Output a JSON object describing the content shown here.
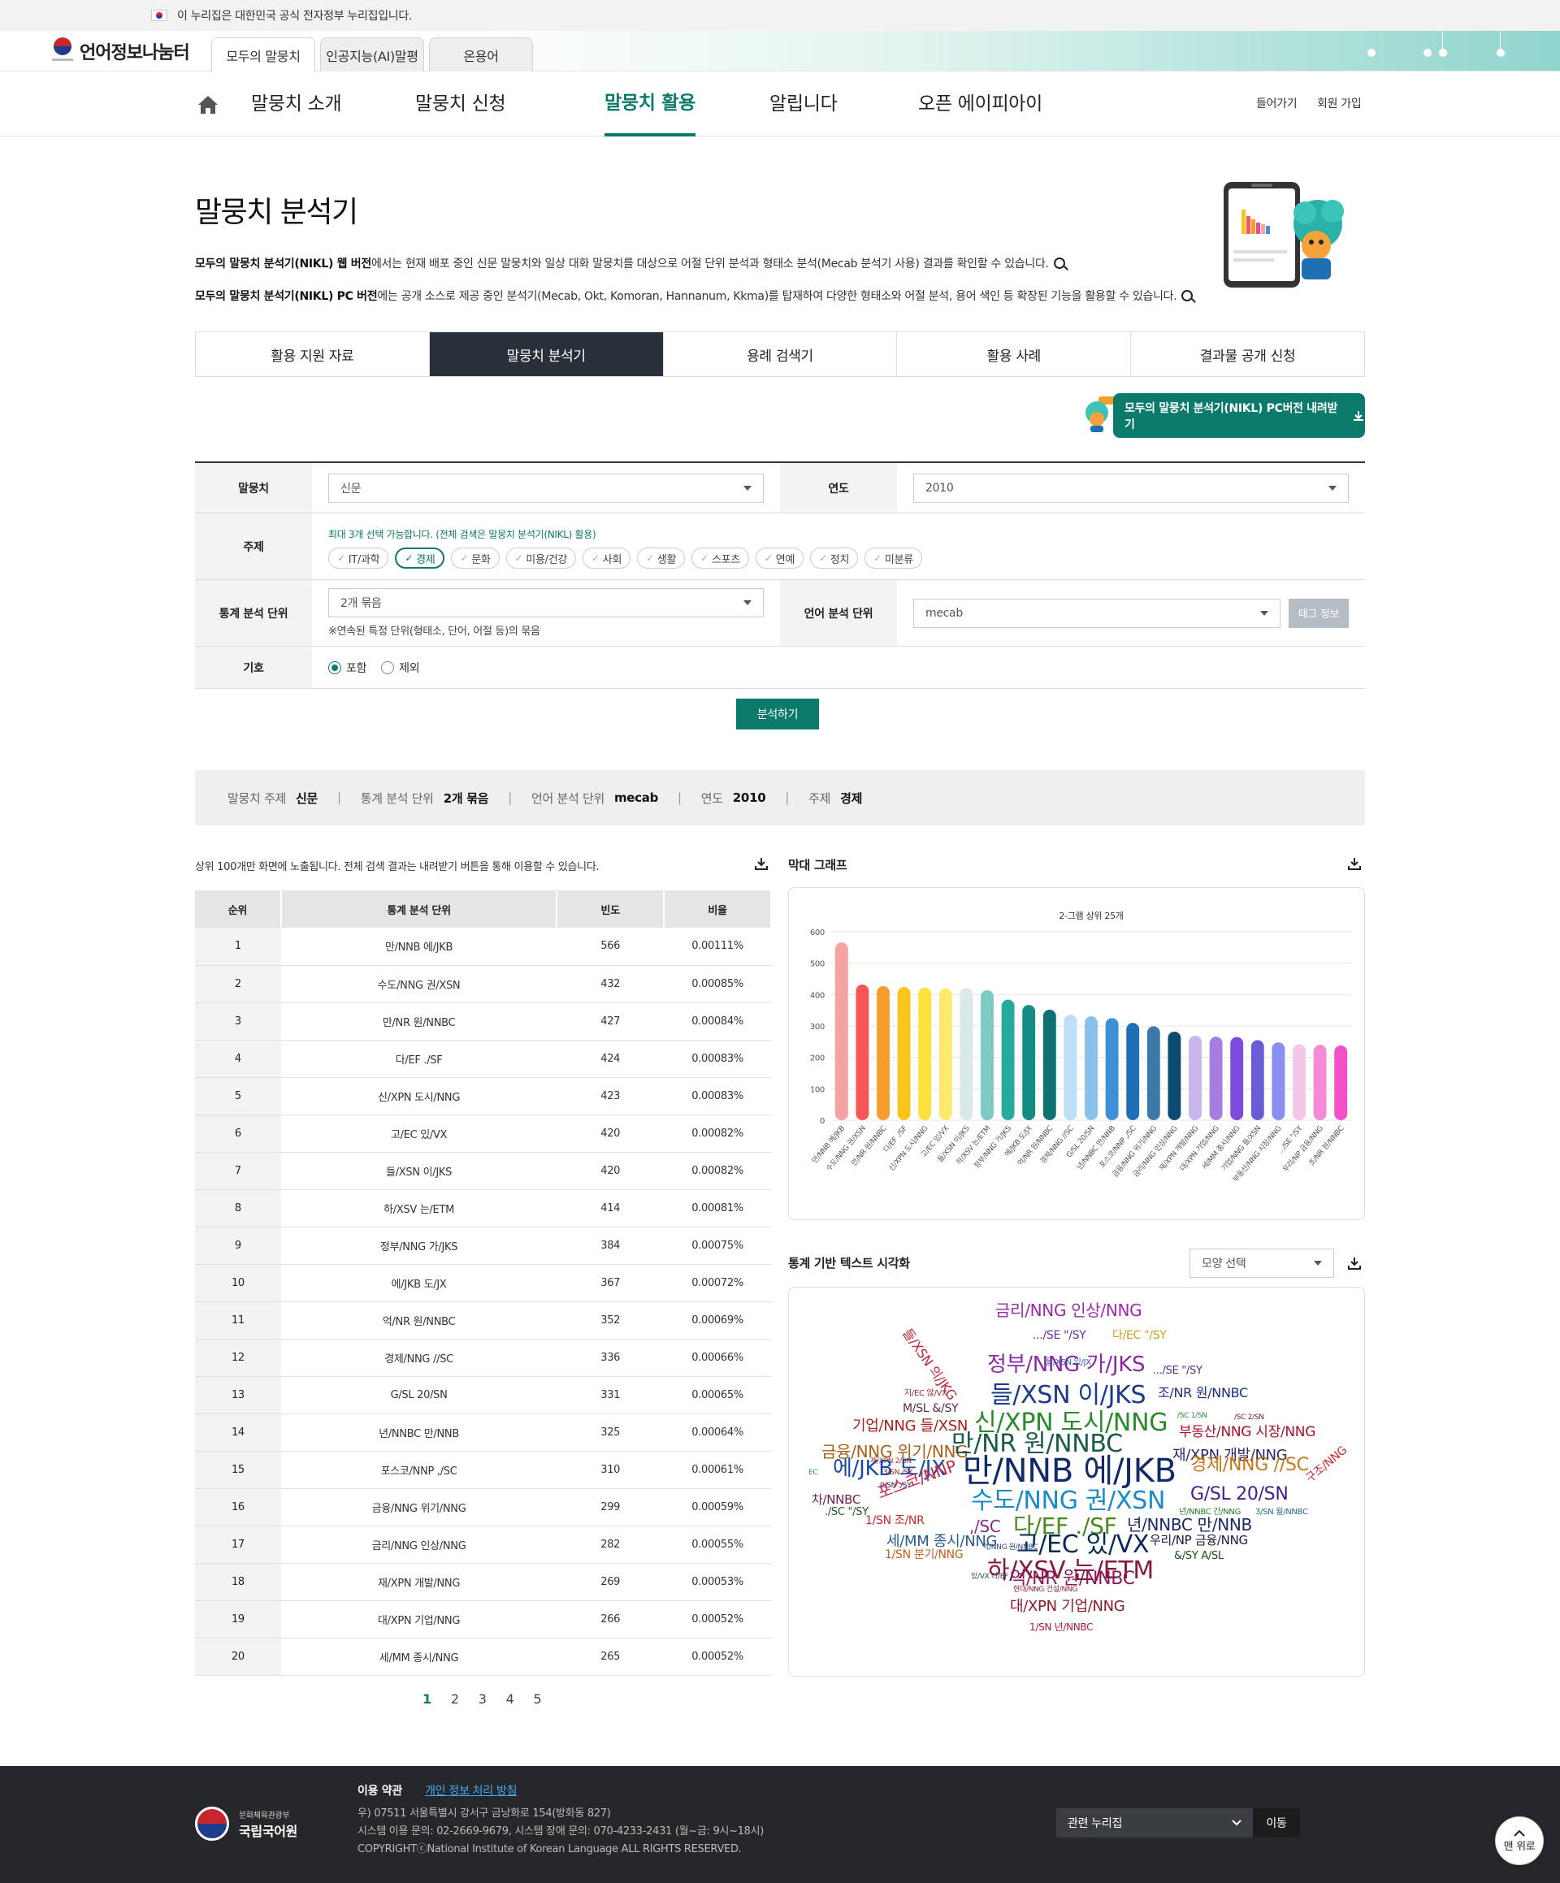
{
  "gov_banner": "이 누리집은 대한민국 공식 전자정부 누리집입니다.",
  "logo": "언어정보나눔터",
  "site_tabs": [
    "모두의 말뭉치",
    "인공지능(AI)말평",
    "온용어"
  ],
  "gnb": [
    "말뭉치 소개",
    "말뭉치 신청",
    "말뭉치 활용",
    "알립니다",
    "오픈 에이피아이"
  ],
  "util": {
    "login": "들어가기",
    "join": "회원 가입"
  },
  "page_title": "말뭉치 분석기",
  "desc1": {
    "bold": "모두의 말뭉치 분석기(NIKL) 웹 버전",
    "text": "에서는 현재 배포 중인 신문 말뭉치와 일상 대화 말뭉치를 대상으로 어절 단위 분석과 형태소 분석(Mecab 분석기 사용) 결과를 확인할 수 있습니다."
  },
  "desc2": {
    "bold": "모두의 말뭉치 분석기(NIKL) PC 버전",
    "text": "에는 공개 소스로 제공 중인 분석기(Mecab, Okt, Komoran, Hannanum, Kkma)를 탑재하여 다양한 형태소와 어절 분석, 용어 색인 등 확장된 기능을 활용할 수 있습니다."
  },
  "subtabs": [
    "활용 지원 자료",
    "말뭉치 분석기",
    "용례 검색기",
    "활용 사례",
    "결과물 공개 신청"
  ],
  "download_btn": "모두의 말뭉치 분석기(NIKL) PC버전 내려받기",
  "form": {
    "corpus_label": "말뭉치",
    "corpus_value": "신문",
    "year_label": "연도",
    "year_value": "2010",
    "topic_label": "주제",
    "topic_note": "최대 3개 선택 가능합니다. (전체 검색은 말뭉치 분석기(NIKL) 활용)",
    "topics": [
      "IT/과학",
      "경제",
      "문화",
      "미용/건강",
      "사회",
      "생활",
      "스포츠",
      "연예",
      "정치",
      "미분류"
    ],
    "unit_label": "통계 분석 단위",
    "unit_value": "2개 묶음",
    "unit_note": "※연속된 특정 단위(형태소, 단어, 어절 등)의 묶음",
    "lang_label": "언어 분석 단위",
    "lang_value": "mecab",
    "tag_btn": "태그 정보",
    "symbol_label": "기호",
    "symbol_on": "포함",
    "symbol_off": "제외",
    "analyze": "분석하기"
  },
  "summary": [
    {
      "k": "말뭉치 주제",
      "v": "신문"
    },
    {
      "k": "통계 분석 단위",
      "v": "2개 묶음"
    },
    {
      "k": "언어 분석 단위",
      "v": "mecab"
    },
    {
      "k": "연도",
      "v": "2010"
    },
    {
      "k": "주제",
      "v": "경제"
    }
  ],
  "table_note": "상위 100개만 화면에 노출됩니다. 전체 검색 결과는 내려받기 버튼을 통해 이용할 수 있습니다.",
  "table": {
    "headers": [
      "순위",
      "통계 분석 단위",
      "빈도",
      "비율"
    ],
    "rows": [
      [
        "1",
        "만/NNB 에/JKB",
        "566",
        "0.00111%"
      ],
      [
        "2",
        "수도/NNG 권/XSN",
        "432",
        "0.00085%"
      ],
      [
        "3",
        "만/NR 원/NNBC",
        "427",
        "0.00084%"
      ],
      [
        "4",
        "다/EF ./SF",
        "424",
        "0.00083%"
      ],
      [
        "5",
        "신/XPN 도시/NNG",
        "423",
        "0.00083%"
      ],
      [
        "6",
        "고/EC 있/VX",
        "420",
        "0.00082%"
      ],
      [
        "7",
        "들/XSN 이/JKS",
        "420",
        "0.00082%"
      ],
      [
        "8",
        "하/XSV 는/ETM",
        "414",
        "0.00081%"
      ],
      [
        "9",
        "정부/NNG 가/JKS",
        "384",
        "0.00075%"
      ],
      [
        "10",
        "에/JKB 도/JX",
        "367",
        "0.00072%"
      ],
      [
        "11",
        "억/NR 원/NNBC",
        "352",
        "0.00069%"
      ],
      [
        "12",
        "경제/NNG //SC",
        "336",
        "0.00066%"
      ],
      [
        "13",
        "G/SL 20/SN",
        "331",
        "0.00065%"
      ],
      [
        "14",
        "년/NNBC 만/NNB",
        "325",
        "0.00064%"
      ],
      [
        "15",
        "포스코/NNP ,/SC",
        "310",
        "0.00061%"
      ],
      [
        "16",
        "금융/NNG 위기/NNG",
        "299",
        "0.00059%"
      ],
      [
        "17",
        "금리/NNG 인상/NNG",
        "282",
        "0.00055%"
      ],
      [
        "18",
        "재/XPN 개발/NNG",
        "269",
        "0.00053%"
      ],
      [
        "19",
        "대/XPN 기업/NNG",
        "266",
        "0.00052%"
      ],
      [
        "20",
        "세/MM 종시/NNG",
        "265",
        "0.00052%"
      ]
    ]
  },
  "pager": [
    "1",
    "2",
    "3",
    "4",
    "5"
  ],
  "bar_section_title": "막대 그래프",
  "wc_section_title": "통계 기반 텍스트 시각화",
  "shape_select": "모양 선택",
  "chart_data": {
    "type": "bar",
    "title": "2-그램 상위 25개",
    "ylim": [
      0,
      600
    ],
    "yticks": [
      0,
      100,
      200,
      300,
      400,
      500,
      600
    ],
    "categories": [
      "만/NNB 에/JKB",
      "수도/NNG 권/XSN",
      "만/NR 원/NNBC",
      "다/EF ./SF",
      "신/XPN 도시/NNG",
      "고/EC 있/VX",
      "들/XSN 이/JKS",
      "하/XSV 는/ETM",
      "정부/NNG 가/JKS",
      "에/JKB 도/JX",
      "억/NR 원/NNBC",
      "경제/NNG //SC",
      "G/SL 20/SN",
      "년/NNBC 만/NNB",
      "포스코/NNP ,/SC",
      "금융/NNG 위기/NNG",
      "금리/NNG 인상/NNG",
      "재/XPN 개발/NNG",
      "대/XPN 기업/NNG",
      "세/MM 종시/NNG",
      "기업/NNG 들/XSN",
      "부동산/NNG 시장/NNG",
      ".../SE \"/SY",
      "우리/NP 금융/NNG",
      "조/NR 원/NNBC"
    ],
    "values": [
      566,
      432,
      427,
      424,
      423,
      420,
      420,
      414,
      384,
      367,
      352,
      336,
      331,
      325,
      310,
      299,
      282,
      269,
      266,
      265,
      255,
      248,
      242,
      240,
      238
    ],
    "colors": [
      "#f6a2a2",
      "#f65656",
      "#f59e2e",
      "#f9c51c",
      "#fbe23c",
      "#fde96e",
      "#dbe8ea",
      "#7ecac4",
      "#26aaa0",
      "#148c80",
      "#0e7272",
      "#bde0f6",
      "#88c2ec",
      "#3d8fd8",
      "#1f6fb4",
      "#3c78a8",
      "#0d4a72",
      "#c8b6ec",
      "#a57ee0",
      "#7d4adc",
      "#6a5cd4",
      "#8a8ef0",
      "#f6c6e6",
      "#f68ad6",
      "#f250c8"
    ]
  },
  "wordcloud": [
    {
      "t": "금리/NNG 인상/NNG",
      "c": "#9b2aa8",
      "s": 20
    },
    {
      "t": ".../SE \"/SY",
      "c": "#6a2ca0",
      "s": 14
    },
    {
      "t": "다/EC \"/SY",
      "c": "#c8a020",
      "s": 14
    },
    {
      "t": "들/XSN 의/JKG",
      "c": "#c0283c",
      "s": 16
    },
    {
      "t": "정부/NNG 가/JKS",
      "c": "#8a28a8",
      "s": 26
    },
    {
      "t": "들/XSN 있/JX",
      "c": "#3050a0",
      "s": 10
    },
    {
      "t": ".../SE \"/SY",
      "c": "#5a2a8a",
      "s": 13
    },
    {
      "t": "지/EC 않/VX",
      "c": "#a82a2a",
      "s": 10
    },
    {
      "t": "M/SL &/SY",
      "c": "#5a2a40",
      "s": 14
    },
    {
      "t": "들/XSN 이/JKS",
      "c": "#1a3a8a",
      "s": 30
    },
    {
      "t": "조/NR 원/NNBC",
      "c": "#1a2a7a",
      "s": 16
    },
    {
      "t": "/SC 1/SN",
      "c": "#2a8a3a",
      "s": 9
    },
    {
      "t": "/SC 2/SN",
      "c": "#6a2a2a",
      "s": 9
    },
    {
      "t": "기업/NNG 들/XSN",
      "c": "#a8201a",
      "s": 18
    },
    {
      "t": "신/XPN 도시/NNG",
      "c": "#2a8a2a",
      "s": 30
    },
    {
      "t": "부동산/NNG 시장/NNG",
      "c": "#a8102a",
      "s": 17
    },
    {
      "t": "금융/NNG 위기/NNG",
      "c": "#a8601a",
      "s": 20
    },
    {
      "t": "만/NR 원/NNBC",
      "c": "#1a5a4a",
      "s": 30
    },
    {
      "t": "재/XPN 개발/NNG",
      "c": "#2a2a6a",
      "s": 18
    },
    {
      "t": "제/XPN 2/SN",
      "c": "#c82a2a",
      "s": 9
    },
    {
      "t": "에/JKB 도/JX",
      "c": "#1a4aa8",
      "s": 26
    },
    {
      "t": "만/NNB 에/JKB",
      "c": "#102a6a",
      "s": 40
    },
    {
      "t": "경제/NNG //SC",
      "c": "#c87a1a",
      "s": 22
    },
    {
      "t": "EC",
      "c": "#2a8a8a",
      "s": 9
    },
    {
      "t": "3/SN /SY",
      "c": "#8a2a2a",
      "s": 9
    },
    {
      "t": "0/SN ./SY",
      "c": "#1a1a6a",
      "s": 9
    },
    {
      "t": "차/NNBC",
      "c": "#6a1a4a",
      "s": 15
    },
    {
      "t": "포스코/NNP",
      "c": "#c82a4a",
      "s": 20
    },
    {
      "t": "수도/NNG 권/XSN",
      "c": "#1a8ac8",
      "s": 30
    },
    {
      "t": "G/SL 20/SN",
      "c": "#4a1a8a",
      "s": 22
    },
    {
      "t": "구조/NNG",
      "c": "#c82a2a",
      "s": 14
    },
    {
      "t": "./SC \"/SY",
      "c": "#1a5a1a",
      "s": 13
    },
    {
      "t": "년/NNBC 간/NNG",
      "c": "#2a7a2a",
      "s": 10
    },
    {
      "t": "3/SN 월/NNBC",
      "c": "#2a6a8a",
      "s": 10
    },
    {
      "t": "1/SN 조/NR",
      "c": "#c82a2a",
      "s": 14
    },
    {
      "t": ",/SC",
      "c": "#8a2a8a",
      "s": 20
    },
    {
      "t": "다/EF ./SF",
      "c": "#4a8a1a",
      "s": 28
    },
    {
      "t": "년/NNBC 만/NNB",
      "c": "#1a2a6a",
      "s": 20
    },
    {
      "t": "세/MM 종시/NNG",
      "c": "#2a5a8a",
      "s": 18
    },
    {
      "t": "고/EC 있/VX",
      "c": "#0a2a5a",
      "s": 30
    },
    {
      "t": "우리/NP 금융/NNG",
      "c": "#1a1a3a",
      "s": 15
    },
    {
      "t": "억/NNG 원/NNBC",
      "c": "#2a4a8a",
      "s": 9
    },
    {
      "t": "1/SN 분기/NNG",
      "c": "#c8601a",
      "s": 14
    },
    {
      "t": "&/SY A/SL",
      "c": "#1a4a1a",
      "s": 13
    },
    {
      "t": "하/XSV 는/ETM",
      "c": "#8a1a3a",
      "s": 30
    },
    {
      "t": "있/VX 다/EF",
      "c": "#2a4a6a",
      "s": 9
    },
    {
      "t": "억/NR 원/NNBC",
      "c": "#8a1a5a",
      "s": 22
    },
    {
      "t": "현대/NNG 건설/NNG",
      "c": "#8a2a3a",
      "s": 9
    },
    {
      "t": "대/XPN 기업/NNG",
      "c": "#8a1a2a",
      "s": 18
    },
    {
      "t": "1/SN 년/NNBC",
      "c": "#a81a3a",
      "s": 12
    }
  ],
  "footer": {
    "org": "국립국어원",
    "org_sub": "문화체육관광부",
    "terms": "이용 약관",
    "privacy": "개인 정보 처리 방침",
    "addr1": "우) 07511 서울특별시 강서구 금낭화로 154(방화동 827)",
    "addr2": "시스템 이용 문의: 02-2669-9679, 시스템 장애 문의: 070-4233-2431 (월~금: 9시~18시)",
    "copyright": "COPYRIGHTⓒNational Institute of Korean Language ALL RIGHTS RESERVED.",
    "related": "관련 누리집",
    "go": "이동"
  },
  "top_btn": "맨 위로"
}
